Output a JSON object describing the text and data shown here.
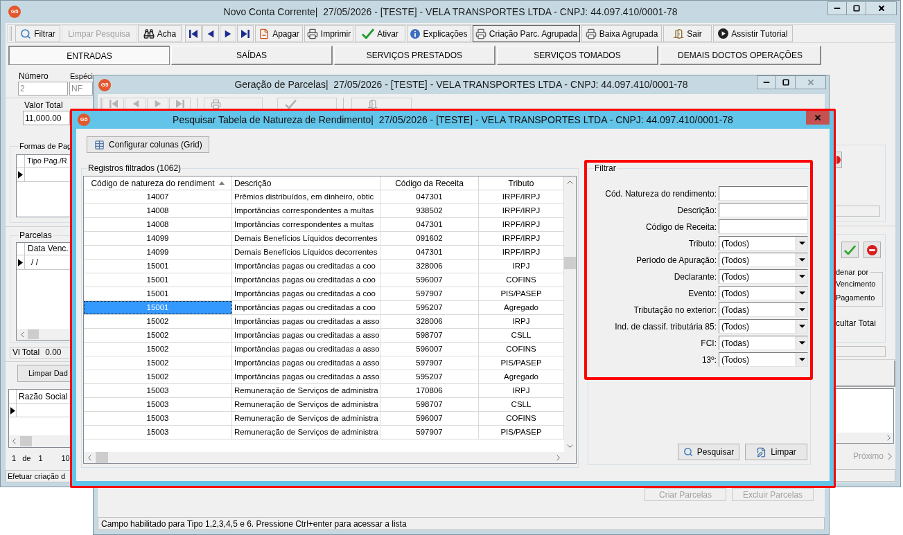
{
  "main_window": {
    "logo": "G5",
    "title": "Novo Conta Corrente|  27/05/2026 - [TESTE] - VELA TRANSPORTES LTDA - CNPJ: 44.097.410/0001-78",
    "close_disabled": false,
    "toolbar": [
      {
        "label": "Filtrar",
        "disabled": false,
        "focused": false
      },
      {
        "label": "Limpar Pesquisa",
        "disabled": true,
        "focused": false
      },
      {
        "label": "Acha",
        "disabled": false,
        "focused": false
      },
      {
        "label": "Apagar",
        "disabled": false,
        "focused": false
      },
      {
        "label": "Imprimir",
        "disabled": false,
        "focused": false
      },
      {
        "label": "Ativar",
        "disabled": false,
        "focused": false
      },
      {
        "label": "Explicações",
        "disabled": false,
        "focused": false
      },
      {
        "label": "Criação Parc. Agrupada",
        "disabled": false,
        "focused": true
      },
      {
        "label": "Baixa Agrupada",
        "disabled": false,
        "focused": false
      },
      {
        "label": "Sair",
        "disabled": false,
        "focused": false
      },
      {
        "label": "Assistir Tutorial",
        "disabled": false,
        "focused": false
      }
    ],
    "tabs": [
      {
        "label": "ENTRADAS",
        "selected": true
      },
      {
        "label": "SAÍDAS",
        "selected": false
      },
      {
        "label": "SERVIÇOS PRESTADOS",
        "selected": false
      },
      {
        "label": "SERVIÇOS TOMADOS",
        "selected": false
      },
      {
        "label": "DEMAIS DOCTOS OPERAÇÕES",
        "selected": false
      }
    ],
    "form_fields": [
      {
        "label": "Número",
        "value": "2",
        "disabled": true
      },
      {
        "label": "Espéci",
        "value": "NF",
        "disabled": true
      },
      {
        "label": "Valor Total",
        "value": "11,000.00",
        "disabled": false
      }
    ],
    "payment_methods": {
      "title": "Formas de Pag",
      "columns": [
        "Tipo Pag./R"
      ]
    },
    "installments": {
      "title": "Parcelas",
      "columns": [
        "Data Venc."
      ],
      "rows": [
        "/ /"
      ]
    },
    "total": {
      "label": "Vl Total",
      "value": "0.00"
    },
    "clear_button": "Limpar Dad",
    "companies": {
      "columns": [
        "Razão Social"
      ]
    },
    "pager": [
      "1",
      "de",
      "1",
      "10"
    ],
    "order_group": {
      "title": "denar por",
      "options": [
        "Vencimento",
        "Pagamento"
      ]
    },
    "hide_totals": "cultar Totai",
    "next_link": {
      "label": "Próximo",
      "disabled": true
    },
    "status_bar": "Efetuar criação d"
  },
  "generation_window": {
    "logo": "G5",
    "title": "Geração de Parcelas|  27/05/2026 - [TESTE] - VELA TRANSPORTES LTDA - CNPJ: 44.097.410/0001-78",
    "close_disabled": true,
    "buttons": [
      {
        "label": "Criar Parcelas",
        "disabled": true
      },
      {
        "label": "Excluir Parcelas",
        "disabled": true
      }
    ],
    "status_bar": "Campo habilitado para Tipo 1,2,3,4,5 e 6. Pressione Ctrl+enter para acessar a lista"
  },
  "search_dialog": {
    "logo": "G5",
    "title": "Pesquisar Tabela de Natureza de Rendimento|  27/05/2026 - [TESTE] - VELA TRANSPORTES LTDA - CNPJ: 44.097.410/0001-78",
    "configure_button": "Configurar colunas (Grid)",
    "results": {
      "title": "Registros filtrados (1062)",
      "columns": [
        {
          "label": "Código de natureza do rendiment",
          "sorted": true
        },
        {
          "label": "Descrição",
          "sorted": false
        },
        {
          "label": "Código da Receita",
          "sorted": false
        },
        {
          "label": "Tributo",
          "sorted": false
        }
      ],
      "rows": [
        {
          "code": "14007",
          "description": "Prêmios distribuídos, em dinheiro, obtic",
          "revenue_code": "047301",
          "tax": "IRPF/IRPJ",
          "selected": false
        },
        {
          "code": "14008",
          "description": "Importâncias correspondentes a multas",
          "revenue_code": "938502",
          "tax": "IRPF/IRPJ",
          "selected": false
        },
        {
          "code": "14008",
          "description": "Importâncias correspondentes a multas",
          "revenue_code": "047301",
          "tax": "IRPF/IRPJ",
          "selected": false
        },
        {
          "code": "14099",
          "description": "Demais Benefícios Líquidos decorrentes",
          "revenue_code": "091602",
          "tax": "IRPF/IRPJ",
          "selected": false
        },
        {
          "code": "14099",
          "description": "Demais Benefícios Líquidos decorrentes",
          "revenue_code": "047301",
          "tax": "IRPF/IRPJ",
          "selected": false
        },
        {
          "code": "15001",
          "description": "Importâncias pagas ou creditadas a coo",
          "revenue_code": "328006",
          "tax": "IRPJ",
          "selected": false
        },
        {
          "code": "15001",
          "description": "Importâncias pagas ou creditadas a coo",
          "revenue_code": "596007",
          "tax": "COFINS",
          "selected": false
        },
        {
          "code": "15001",
          "description": "Importâncias pagas ou creditadas a coo",
          "revenue_code": "597907",
          "tax": "PIS/PASEP",
          "selected": false
        },
        {
          "code": "15001",
          "description": "Importâncias pagas ou creditadas a coo",
          "revenue_code": "595207",
          "tax": "Agregado",
          "selected": true
        },
        {
          "code": "15002",
          "description": "Importâncias pagas ou creditadas a asso",
          "revenue_code": "328006",
          "tax": "IRPJ",
          "selected": false
        },
        {
          "code": "15002",
          "description": "Importâncias pagas ou creditadas a asso",
          "revenue_code": "598707",
          "tax": "CSLL",
          "selected": false
        },
        {
          "code": "15002",
          "description": "Importâncias pagas ou creditadas a asso",
          "revenue_code": "596007",
          "tax": "COFINS",
          "selected": false
        },
        {
          "code": "15002",
          "description": "Importâncias pagas ou creditadas a asso",
          "revenue_code": "597907",
          "tax": "PIS/PASEP",
          "selected": false
        },
        {
          "code": "15002",
          "description": "Importâncias pagas ou creditadas a asso",
          "revenue_code": "595207",
          "tax": "Agregado",
          "selected": false
        },
        {
          "code": "15003",
          "description": "Remuneração de Serviços de administra",
          "revenue_code": "170806",
          "tax": "IRPJ",
          "selected": false
        },
        {
          "code": "15003",
          "description": "Remuneração de Serviços de administra",
          "revenue_code": "598707",
          "tax": "CSLL",
          "selected": false
        },
        {
          "code": "15003",
          "description": "Remuneração de Serviços de administra",
          "revenue_code": "596007",
          "tax": "COFINS",
          "selected": false
        },
        {
          "code": "15003",
          "description": "Remuneração de Serviços de administra",
          "revenue_code": "597907",
          "tax": "PIS/PASEP",
          "selected": false
        }
      ]
    },
    "filter": {
      "title": "Filtrar",
      "fields": [
        {
          "label": "Cód. Natureza do rendimento:",
          "kind": "text"
        },
        {
          "label": "Descrição:",
          "kind": "text"
        },
        {
          "label": "Código de Receita:",
          "kind": "text"
        },
        {
          "label": "Tributo:",
          "kind": "select",
          "value": "(Todos)"
        },
        {
          "label": "Período de Apuração:",
          "kind": "select",
          "value": "(Todos)"
        },
        {
          "label": "Declarante:",
          "kind": "select",
          "value": "(Todos)"
        },
        {
          "label": "Evento:",
          "kind": "select",
          "value": "(Todos)"
        },
        {
          "label": "Tributação no exterior:",
          "kind": "select",
          "value": "(Todas)"
        },
        {
          "label": "Ind. de classif. tributária 85:",
          "kind": "select",
          "value": "(Todos)"
        },
        {
          "label": "FCI:",
          "kind": "select",
          "value": "(Todas)"
        },
        {
          "label": "13º:",
          "kind": "select",
          "value": "(Todos)"
        }
      ],
      "buttons": [
        "Pesquisar",
        "Limpar"
      ]
    }
  }
}
